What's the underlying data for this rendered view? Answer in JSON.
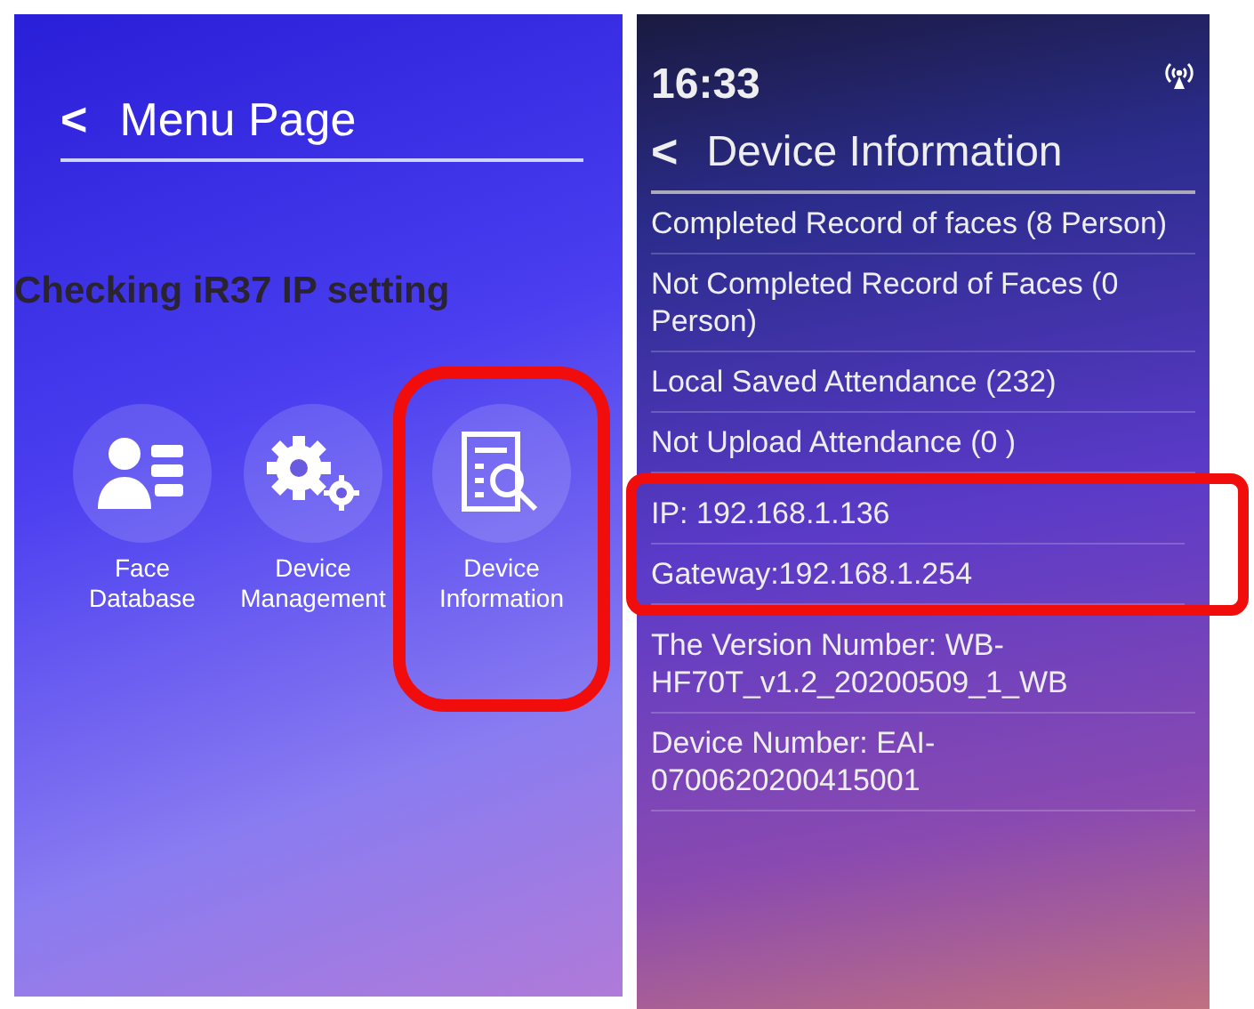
{
  "caption": "Checking iR37 IP setting",
  "menu_page": {
    "back": "<",
    "title": "Menu Page",
    "tiles": [
      {
        "kind": "face",
        "label": "Face Database",
        "highlighted": false
      },
      {
        "kind": "gear",
        "label": "Device Management",
        "highlighted": false
      },
      {
        "kind": "info",
        "label": "Device Information",
        "highlighted": true
      }
    ]
  },
  "device_info": {
    "time": "16:33",
    "back": "<",
    "title": "Device Information",
    "rows": [
      {
        "text": "Completed Record of faces (8 Person)",
        "highlighted": false
      },
      {
        "text": "Not Completed Record of Faces (0 Person)",
        "highlighted": false
      },
      {
        "text": "Local Saved Attendance (232)",
        "highlighted": false
      },
      {
        "text": "Not Upload Attendance (0 )",
        "highlighted": false
      },
      {
        "text": "IP: 192.168.1.136",
        "highlighted": true
      },
      {
        "text": "Gateway:192.168.1.254",
        "highlighted": true
      },
      {
        "text": "The Version Number: WB-HF70T_v1.2_20200509_1_WB",
        "highlighted": false
      },
      {
        "text": "Device Number: EAI-0700620200415001",
        "highlighted": false
      }
    ]
  }
}
